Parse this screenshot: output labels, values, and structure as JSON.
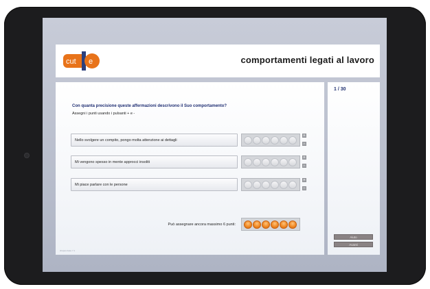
{
  "app": {
    "logo_text": "cut-e",
    "title": "comportamenti legati al lavoro",
    "version": "shapes-base 7.1"
  },
  "question": {
    "text": "Con quanta precisione queste affermazioni descrivono il Suo comportamento?",
    "instruction": "Assegni i punti usando i pulsanti  + e -"
  },
  "items": [
    {
      "label": "Nello svolgere un compito, pongo molta attenzione ai dettagli",
      "points": 0
    },
    {
      "label": "Mi vengono spesso in mente approcci insoliti",
      "points": 0
    },
    {
      "label": "Mi piace parlare con le persone",
      "points": 0
    }
  ],
  "controls": {
    "plus": "+",
    "minus": "-"
  },
  "remaining": {
    "label": "Può assegnare ancora massimo 6 punti:",
    "points": 6
  },
  "progress": "1 / 30",
  "buttons": {
    "help": "Aiuto",
    "next": "Avanti"
  },
  "colors": {
    "accent": "#e8731a",
    "title_blue": "#1f2f73",
    "button_gray": "#8a8384"
  }
}
